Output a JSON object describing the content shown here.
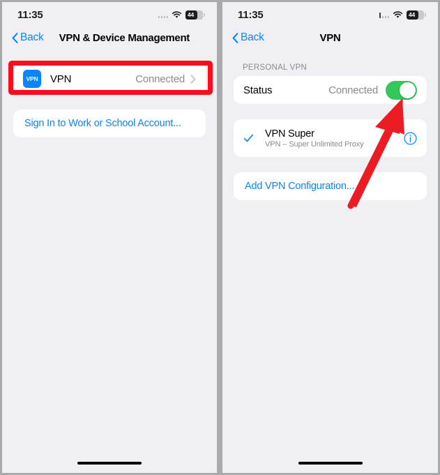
{
  "meta": {
    "accent_blue": "#0a84ff",
    "toggle_green": "#34c759",
    "annotation_red": "#fc0d1b",
    "background_gray": "#f0eff4",
    "divider_gray": "#a9aaae"
  },
  "left_panel": {
    "status_bar": {
      "time": "11:35",
      "battery_percent": "44",
      "wifi_icon": "wifi-icon",
      "signal_icon": "cellular-signal-icon",
      "battery_icon": "battery-icon"
    },
    "nav": {
      "back_label": "Back",
      "back_icon": "chevron-left-icon",
      "title": "VPN & Device Management"
    },
    "vpn_row": {
      "icon_text": "VPN",
      "icon_name": "vpn-app-icon",
      "label": "VPN",
      "value": "Connected",
      "chevron_icon": "chevron-right-icon"
    },
    "sign_in_row": {
      "label": "Sign In to Work or School Account..."
    }
  },
  "right_panel": {
    "status_bar": {
      "time": "11:35",
      "battery_percent": "44",
      "wifi_icon": "wifi-icon",
      "signal_icon": "cellular-signal-icon",
      "battery_icon": "battery-icon"
    },
    "nav": {
      "back_label": "Back",
      "back_icon": "chevron-left-icon",
      "title": "VPN"
    },
    "section_header": "PERSONAL VPN",
    "status_row": {
      "label": "Status",
      "value": "Connected",
      "toggle_state": "on",
      "toggle_name": "vpn-status-toggle"
    },
    "config_row": {
      "check_icon": "checkmark-icon",
      "title": "VPN Super",
      "subtitle": "VPN – Super Unlimited Proxy",
      "info_icon": "info-circle-icon"
    },
    "add_config_row": {
      "label": "Add VPN Configuration..."
    }
  },
  "annotations": {
    "highlight_box_target": "vpn-row-highlight",
    "arrow_target": "vpn-status-toggle-arrow"
  }
}
